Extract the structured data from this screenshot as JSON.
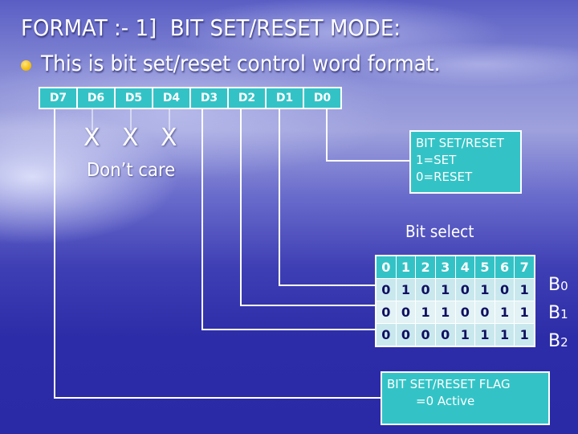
{
  "slide": {
    "title": "FORMAT :- 1]  BIT SET/RESET MODE:",
    "bullet": "This is bit set/reset control word format.",
    "colors": {
      "accent_teal": "#33c3c6",
      "bullet_gold": "#f2b800",
      "table_text": "#101060",
      "line_white": "#ffffff"
    }
  },
  "register": {
    "bits": [
      "D7",
      "D6",
      "D5",
      "D4",
      "D3",
      "D2",
      "D1",
      "D0"
    ]
  },
  "dont_care": {
    "marks": [
      "X",
      "X",
      "X"
    ],
    "label": "Don’t care"
  },
  "bit_set_reset_box": {
    "lines": [
      "BIT SET/RESET",
      "1=SET",
      "0=RESET"
    ]
  },
  "bit_select": {
    "label": "Bit select",
    "header": [
      "0",
      "1",
      "2",
      "3",
      "4",
      "5",
      "6",
      "7"
    ],
    "rows": [
      {
        "label": "B",
        "sub": "0",
        "values": [
          "0",
          "1",
          "0",
          "1",
          "0",
          "1",
          "0",
          "1"
        ]
      },
      {
        "label": "B",
        "sub": "1",
        "values": [
          "0",
          "0",
          "1",
          "1",
          "0",
          "0",
          "1",
          "1"
        ]
      },
      {
        "label": "B",
        "sub": "2",
        "values": [
          "0",
          "0",
          "0",
          "0",
          "1",
          "1",
          "1",
          "1"
        ]
      }
    ]
  },
  "flag_box": {
    "lines": [
      "BIT SET/RESET FLAG",
      "=0 Active"
    ]
  }
}
